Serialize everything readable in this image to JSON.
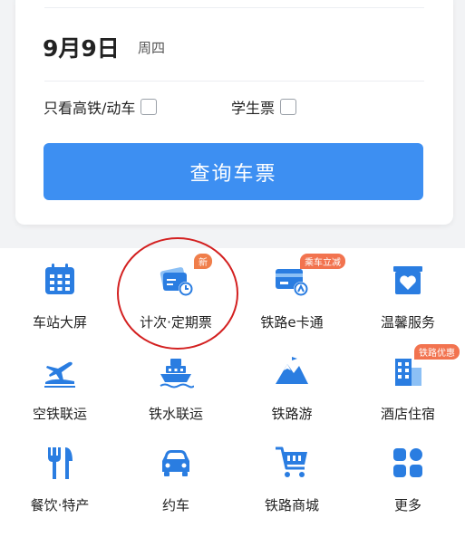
{
  "search_card": {
    "date": "9月9日",
    "weekday": "周四",
    "option_high_speed": "只看高铁/动车",
    "option_student": "学生票",
    "query_button": "查询车票"
  },
  "services": [
    {
      "label": "车站大屏",
      "icon": "station-screen-icon"
    },
    {
      "label": "计次·定期票",
      "icon": "ticket-card-clock-icon",
      "badge": "新"
    },
    {
      "label": "铁路e卡通",
      "icon": "e-card-icon",
      "badge": "乘车立减"
    },
    {
      "label": "温馨服务",
      "icon": "heart-box-icon"
    },
    {
      "label": "空铁联运",
      "icon": "plane-train-icon"
    },
    {
      "label": "铁水联运",
      "icon": "ship-train-icon"
    },
    {
      "label": "铁路游",
      "icon": "mountain-icon"
    },
    {
      "label": "酒店住宿",
      "icon": "hotel-building-icon",
      "badge": "铁路优惠"
    },
    {
      "label": "餐饮·特产",
      "icon": "fork-knife-icon"
    },
    {
      "label": "约车",
      "icon": "car-icon"
    },
    {
      "label": "铁路商城",
      "icon": "shopping-cart-icon"
    },
    {
      "label": "更多",
      "icon": "grid-more-icon"
    }
  ],
  "colors": {
    "accent": "#3d8ff2",
    "icon_primary": "#2a7de1",
    "badge_new": "#f07e4a",
    "badge_promo": "#f2734f",
    "highlight": "#d32020"
  }
}
